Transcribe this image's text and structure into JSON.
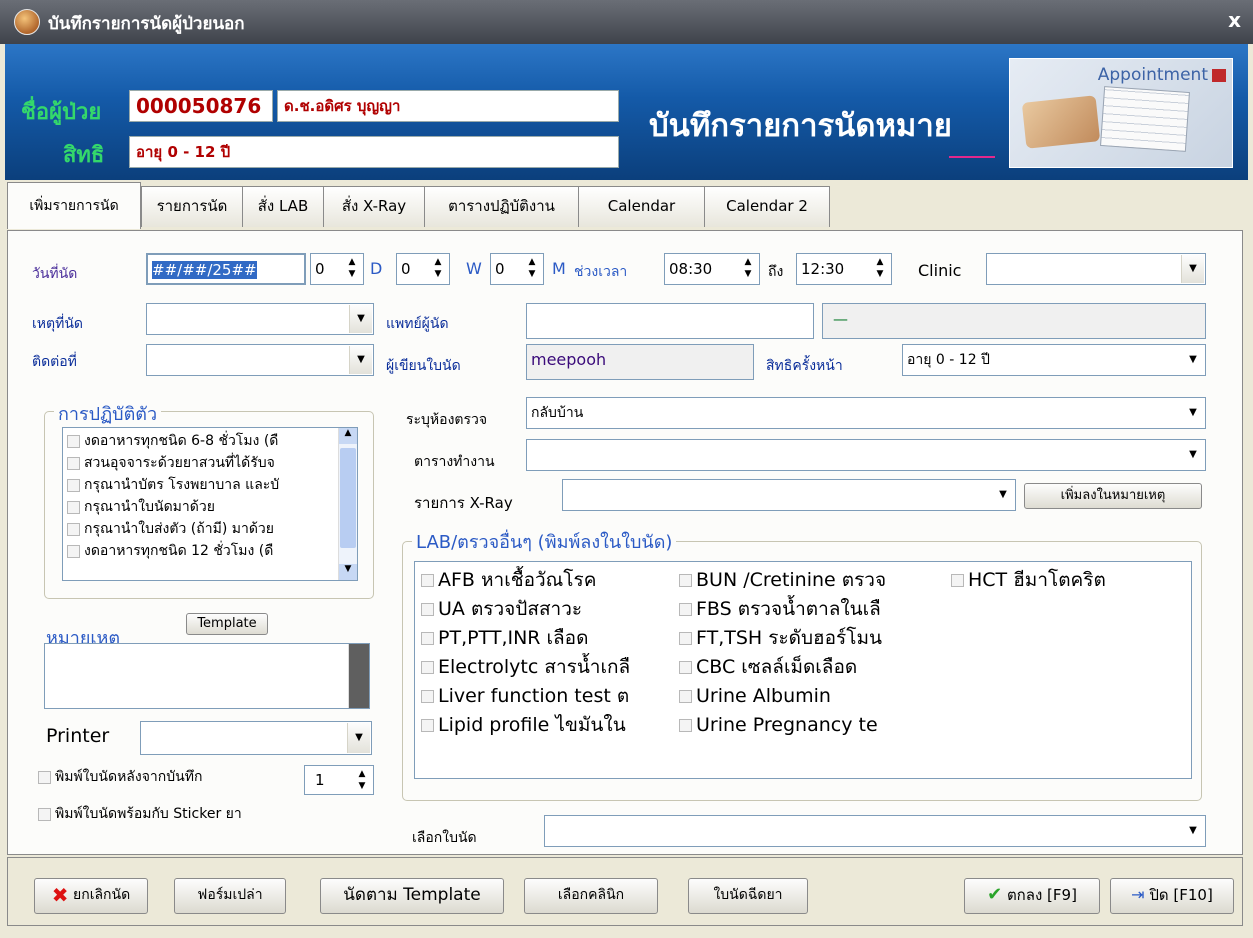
{
  "window": {
    "title": "บันทึกรายการนัดผู้ป่วยนอก",
    "close": "x"
  },
  "header": {
    "patient_label": "ชื่อผู้ป่วย",
    "hn": "000050876",
    "patient_name": "ด.ช.อดิศร บุญญา",
    "right_label": "สิทธิ",
    "right_value": "อายุ 0 - 12 ปี",
    "title": "บันทึกรายการนัดหมาย",
    "appointment_image_text": "Appointment"
  },
  "tabs": [
    "เพิ่มรายการนัด",
    "รายการนัด",
    "สั่ง LAB",
    "สั่ง X-Ray",
    "ตารางปฏิบัติงาน",
    "Calendar",
    "Calendar 2"
  ],
  "form": {
    "date_label": "วันที่นัด",
    "date_value": "##/##/25##",
    "d_value": "0",
    "d_unit": "D",
    "w_value": "0",
    "w_unit": "W",
    "m_value": "0",
    "m_unit": "M",
    "time_label": "ช่วงเวลา",
    "time_from": "08:30",
    "to_label": "ถึง",
    "time_to": "12:30",
    "clinic_label": "Clinic",
    "clinic_value": "",
    "reason_label": "เหตุที่นัด",
    "doctor_label": "แพทย์ผู้นัด",
    "doctor_value": "",
    "doctor_code": "—",
    "contact_label": "ติดต่อที่",
    "writer_label": "ผู้เขียนใบนัด",
    "writer_value": "meepooh",
    "next_right_label": "สิทธิครั้งหน้า",
    "next_right_value": "อายุ 0 - 12 ปี",
    "room_label": "ระบุห้องตรวจ",
    "room_value": "กลับบ้าน",
    "schedule_label": "ตารางทำงาน",
    "xray_label": "รายการ X-Ray",
    "add_note_button": "เพิ่มลงในหมายเหตุ",
    "select_form_label": "เลือกใบนัด"
  },
  "instructions": {
    "title": "การปฏิบัติตัว",
    "items": [
      "งดอาหารทุกชนิด 6-8 ชั่วโมง (ดื",
      "สวนอุจจาระด้วยยาสวนที่ได้รับจ",
      "กรุณานำบัตร โรงพยาบาล และบั",
      "กรุณานำใบนัดมาด้วย",
      "กรุณานำใบส่งตัว (ถ้ามี) มาด้วย",
      "งดอาหารทุกชนิด 12 ชั่วโมง (ดื"
    ]
  },
  "note": {
    "label": "หมายเหตุ",
    "template_button": "Template",
    "value": ""
  },
  "printer": {
    "label": "Printer",
    "value": "",
    "print_after_save": "พิมพ์ใบนัดหลังจากบันทึก",
    "copies": "1",
    "print_with_sticker": "พิมพ์ใบนัดพร้อมกับ Sticker ยา"
  },
  "lab": {
    "title": "LAB/ตรวจอื่นๆ (พิมพ์ลงในใบนัด)",
    "col1": [
      "AFB หาเชื้อวัณโรค",
      "UA ตรวจปัสสาวะ",
      "PT,PTT,INR เลือด",
      "Electrolytc สารน้ำเกลื",
      "Liver function test ต",
      "Lipid profile ไขมันใน"
    ],
    "col2": [
      "BUN /Cretinine ตรวจ",
      "FBS ตรวจน้ำตาลในเลื",
      "FT,TSH ระดับฮอร์โมน",
      "CBC เซลล์เม็ดเลือด",
      "Urine Albumin",
      "Urine Pregnancy te"
    ],
    "col3": [
      "HCT ฮีมาโตคริต"
    ]
  },
  "footer": {
    "cancel": "ยกเลิกนัด",
    "blank_form": "ฟอร์มเปล่า",
    "by_template": "นัดตาม Template",
    "select_clinic": "เลือกคลินิก",
    "injection": "ใบนัดฉีดยา",
    "ok": "ตกลง [F9]",
    "close": "ปิด [F10]"
  },
  "colors": {
    "header_blue": "#145aa8",
    "green_label": "#34d86b",
    "hn_red": "#b00000",
    "group_title": "#2b5ac5"
  }
}
